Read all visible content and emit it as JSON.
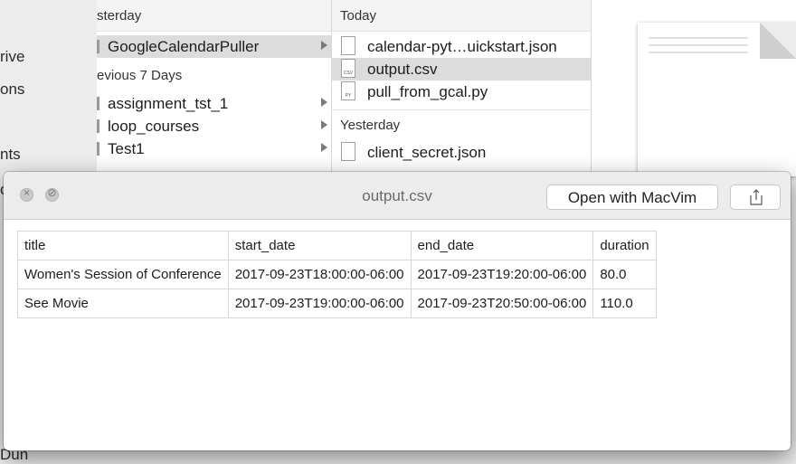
{
  "sidebar": {
    "items": [
      "rive",
      "ons",
      "nts",
      "c",
      "Dun"
    ]
  },
  "column1": {
    "group_yesterday": "sterday",
    "group_prev7": "evious 7 Days",
    "rows": [
      {
        "label": "GoogleCalendarPuller"
      },
      {
        "label": "assignment_tst_1"
      },
      {
        "label": "loop_courses"
      },
      {
        "label": "Test1"
      }
    ]
  },
  "column2": {
    "group_today": "Today",
    "group_yesterday": "Yesterday",
    "rows": [
      {
        "label": "calendar-pyt…uickstart.json",
        "icon": "json-file-icon"
      },
      {
        "label": "output.csv",
        "icon": "csv-file-icon"
      },
      {
        "label": "pull_from_gcal.py",
        "icon": "python-file-icon"
      },
      {
        "label": "client_secret.json",
        "icon": "json-file-icon"
      }
    ]
  },
  "quicklook": {
    "title": "output.csv",
    "open_button": "Open with MacVim",
    "share_icon": "share-icon",
    "close_icon": "close-icon",
    "fullscreen_icon": "fullscreen-icon",
    "table": {
      "headers": [
        "title",
        "start_date",
        "end_date",
        "duration"
      ],
      "rows": [
        [
          "Women's Session of Conference",
          "2017-09-23T18:00:00-06:00",
          "2017-09-23T19:20:00-06:00",
          "80.0"
        ],
        [
          "See Movie",
          "2017-09-23T19:00:00-06:00",
          "2017-09-23T20:50:00-06:00",
          "110.0"
        ]
      ]
    }
  }
}
